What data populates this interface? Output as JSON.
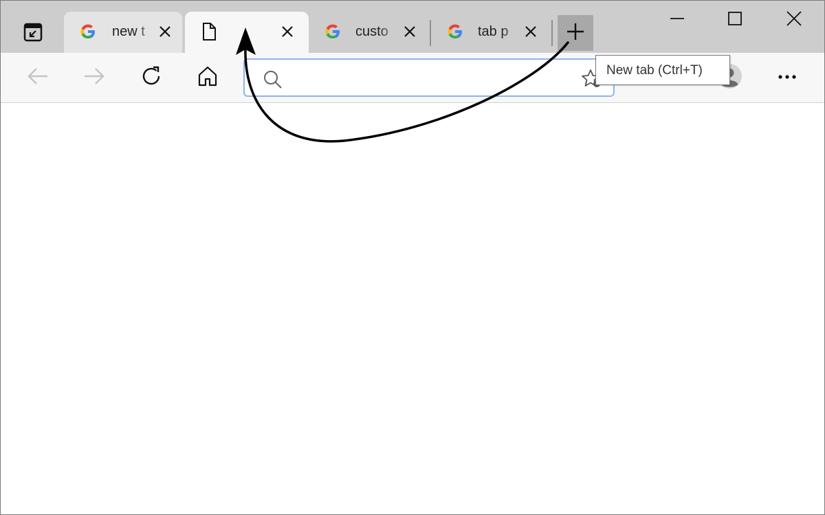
{
  "tabs": [
    {
      "title": "new t",
      "favicon": "google-g-icon",
      "active": false
    },
    {
      "title": "",
      "favicon": "blank-page-icon",
      "active": true
    },
    {
      "title": "custo",
      "favicon": "google-g-icon",
      "active": false
    },
    {
      "title": "tab p",
      "favicon": "google-g-icon",
      "active": false
    }
  ],
  "tooltip": {
    "text": "New tab (Ctrl+T)"
  },
  "address_bar": {
    "value": "",
    "placeholder": ""
  },
  "colors": {
    "tab_strip": "#cdcdcd",
    "active_tab": "#f7f7f7",
    "address_focus": "#8db4ea",
    "annotation_arrow": "#000000"
  },
  "icons": [
    "tab-actions-icon",
    "google-g-icon",
    "blank-page-icon",
    "close-icon",
    "new-tab-plus-icon",
    "minimize-icon",
    "maximize-icon",
    "close-window-icon",
    "back-arrow-icon",
    "forward-arrow-icon",
    "refresh-icon",
    "home-icon",
    "search-icon",
    "favorite-star-icon",
    "profile-avatar-icon",
    "more-options-icon"
  ]
}
